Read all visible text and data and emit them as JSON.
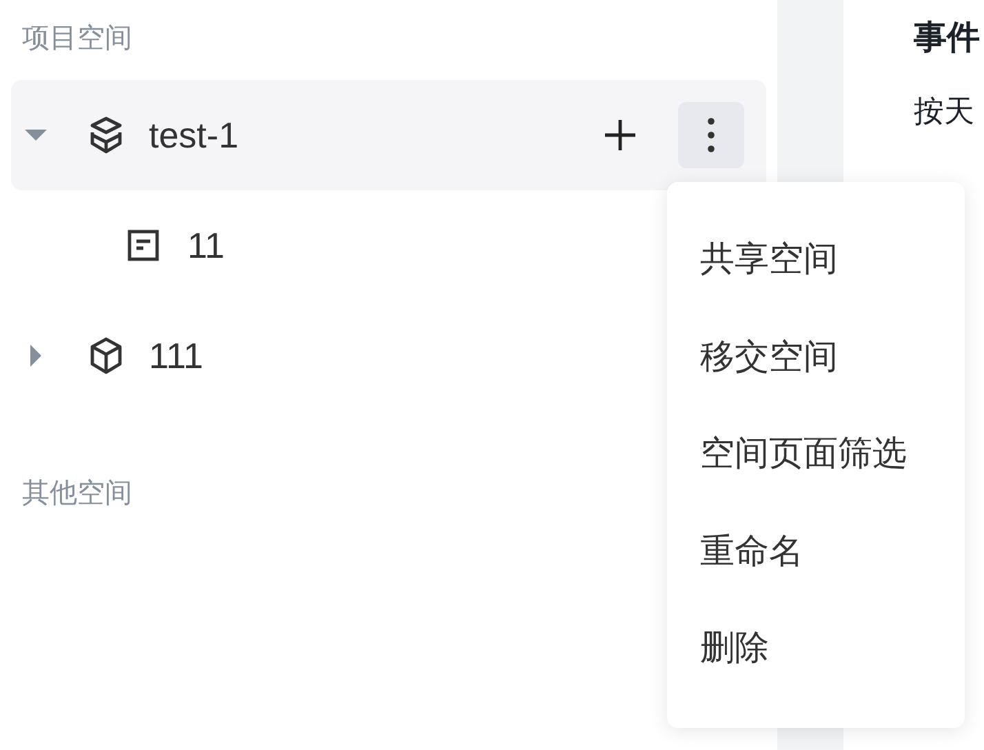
{
  "sections": [
    {
      "title": "项目空间",
      "items": [
        {
          "name": "test-1",
          "kind": "stack",
          "expanded": true,
          "selected": true,
          "children": [
            {
              "name": "11",
              "kind": "page"
            }
          ]
        },
        {
          "name": "111",
          "kind": "cube",
          "expanded": false,
          "selected": false
        }
      ]
    },
    {
      "title": "其他空间"
    }
  ],
  "main": {
    "title": "事件",
    "subtitle": "按天"
  },
  "menu": {
    "items": [
      "共享空间",
      "移交空间",
      "空间页面筛选",
      "重命名",
      "删除"
    ]
  }
}
